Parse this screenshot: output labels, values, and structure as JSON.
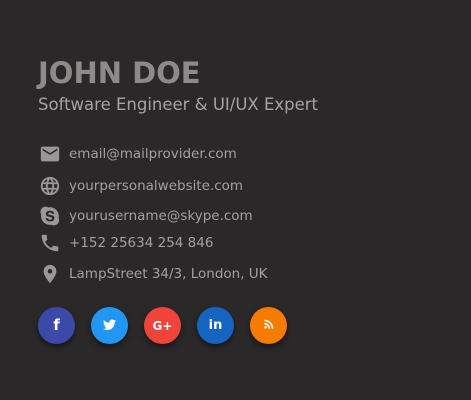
{
  "profile": {
    "name": "JOHN DOE",
    "title": "Software Engineer & UI/UX Expert"
  },
  "contacts": [
    {
      "icon": "mail-icon",
      "text": "email@mailprovider.com"
    },
    {
      "icon": "globe-icon",
      "text": "yourpersonalwebsite.com"
    },
    {
      "icon": "skype-icon",
      "text": "yourusername@skype.com"
    },
    {
      "icon": "phone-icon",
      "text": "+152 25634 254 846"
    },
    {
      "icon": "location-pin-icon",
      "text": "LampStreet 34/3, London, UK"
    }
  ],
  "socials": [
    {
      "icon": "facebook-icon",
      "glyph": "f",
      "color": "#3b4aa8"
    },
    {
      "icon": "twitter-icon",
      "glyph": "🐦",
      "color": "#2196f3"
    },
    {
      "icon": "google-plus-icon",
      "glyph": "G+",
      "color": "#f0443b"
    },
    {
      "icon": "linkedin-icon",
      "glyph": "in",
      "color": "#1565c0"
    },
    {
      "icon": "rss-icon",
      "glyph": "rss",
      "color": "#f57c00"
    }
  ]
}
